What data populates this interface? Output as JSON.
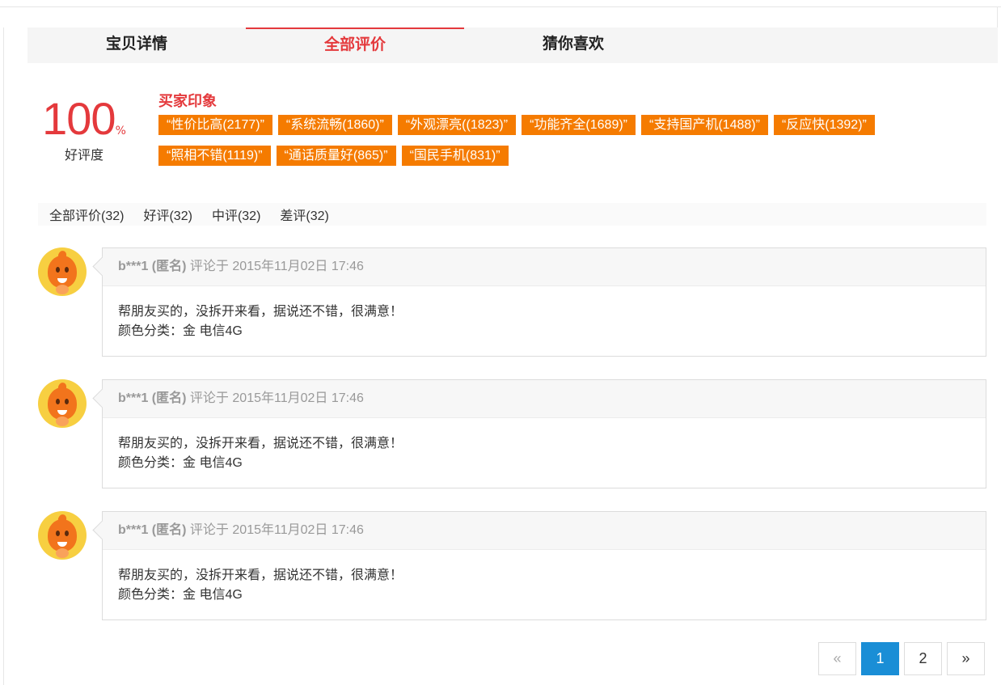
{
  "tabs": [
    {
      "label": "宝贝详情"
    },
    {
      "label": "全部评价"
    },
    {
      "label": "猜你喜欢"
    }
  ],
  "rating": {
    "value": "100",
    "unit": "%",
    "label": "好评度"
  },
  "impression": {
    "title": "买家印象",
    "tags": [
      "“性价比高(2177)”",
      "“系统流畅(1860)”",
      "“外观漂亮((1823)”",
      "“功能齐全(1689)”",
      "“支持国产机(1488)”",
      "“反应快(1392)”",
      "“照相不错(1119)”",
      "“通话质量好(865)”",
      "“国民手机(831)”"
    ]
  },
  "filters": [
    {
      "label": "全部评价(32)"
    },
    {
      "label": "好评(32)"
    },
    {
      "label": "中评(32)"
    },
    {
      "label": "差评(32)"
    }
  ],
  "reviews": [
    {
      "user": "b***1 (匿名)",
      "prefix": "评论于",
      "date": "2015年11月02日 17:46",
      "text": "帮朋友买的，没拆开来看，据说还不错，很满意！",
      "spec": "颜色分类：金 电信4G"
    },
    {
      "user": "b***1 (匿名)",
      "prefix": "评论于",
      "date": "2015年11月02日 17:46",
      "text": "帮朋友买的，没拆开来看，据说还不错，很满意！",
      "spec": "颜色分类：金 电信4G"
    },
    {
      "user": "b***1 (匿名)",
      "prefix": "评论于",
      "date": "2015年11月02日 17:46",
      "text": "帮朋友买的，没拆开来看，据说还不错，很满意！",
      "spec": "颜色分类：金 电信4G"
    }
  ],
  "pagination": {
    "prev": "«",
    "pages": [
      "1",
      "2"
    ],
    "current": "1",
    "next": "»"
  },
  "colors": {
    "accent": "#e4393c",
    "tag": "#f57b00",
    "pager_active": "#1a8ed6"
  }
}
